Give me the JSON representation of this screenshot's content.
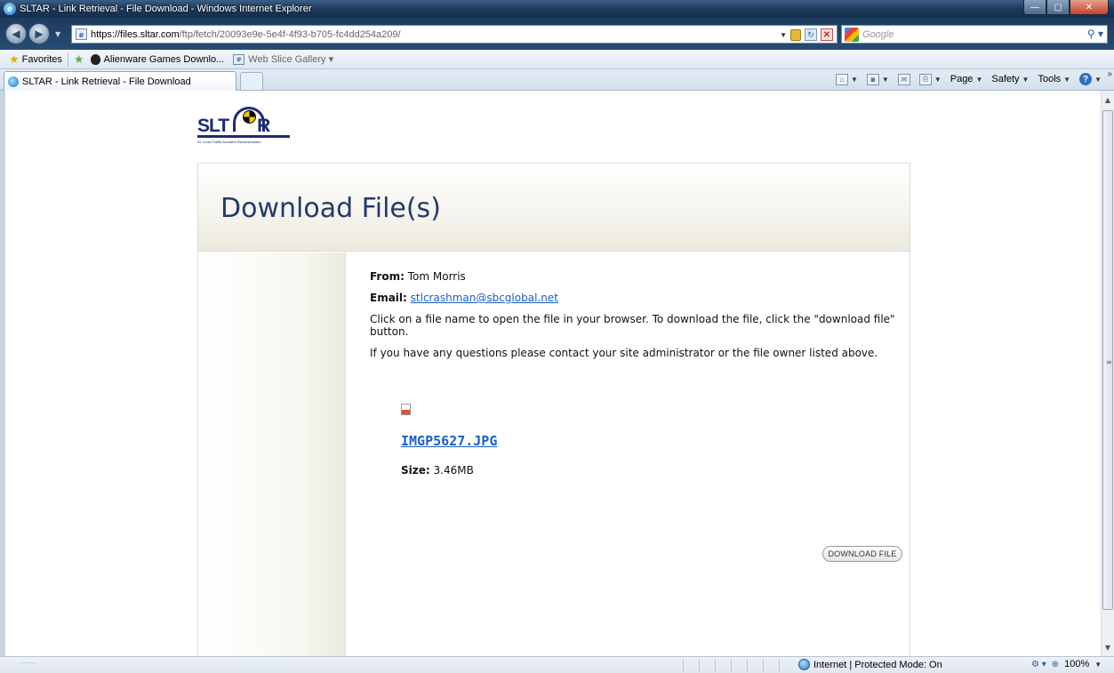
{
  "window": {
    "title": "SLTAR - Link Retrieval - File Download - Windows Internet Explorer",
    "controls": {
      "minimize": "—",
      "maximize": "▢",
      "close": "✕"
    }
  },
  "addressbar": {
    "url_host": "https://files.sltar.com",
    "url_path": "/ftp/fetch/20093e9e-5e4f-4f93-b705-fc4dd254a209/",
    "search_placeholder": "Google",
    "icons": [
      "back-icon",
      "forward-icon",
      "ie-page-icon",
      "lock-icon",
      "refresh-icon",
      "stop-icon",
      "google-icon",
      "search-icon"
    ]
  },
  "favorites_bar": {
    "favorites_label": "Favorites",
    "items": [
      {
        "label": "Alienware Games Downlo...",
        "icon": "alienware-icon"
      },
      {
        "label": "Web Slice Gallery ▾",
        "icon": "web-slice-icon"
      }
    ]
  },
  "tabs": {
    "active_label": "SLTAR - Link Retrieval - File Download"
  },
  "command_bar": {
    "page": "Page",
    "safety": "Safety",
    "tools": "Tools"
  },
  "page": {
    "logo_text_left": "SLT",
    "logo_text_right": "R",
    "logo_tagline": "St. Louis Traffic Accident Reconstruction",
    "heading": "Download File(s)",
    "from_label": "From:",
    "from_value": "Tom Morris",
    "email_label": "Email:",
    "email_value": "stlcrashman@sbcglobal.net",
    "instructions": "Click on a file name to open the file in your browser. To download the file, click the \"download file\" button.",
    "contact_note": "If you have any questions please contact your site administrator or the file owner listed above.",
    "file": {
      "name": "IMGP5627.JPG",
      "size_label": "Size:",
      "size_value": "3.46MB",
      "download_button": "DOWNLOAD FILE"
    }
  },
  "statusbar": {
    "zone": "Internet | Protected Mode: On",
    "zoom": "100%"
  },
  "colors": {
    "heading": "#233a6b",
    "link": "#1a5fc9",
    "logo": "#1d2a73",
    "titlebar": "#1e3a5a"
  }
}
